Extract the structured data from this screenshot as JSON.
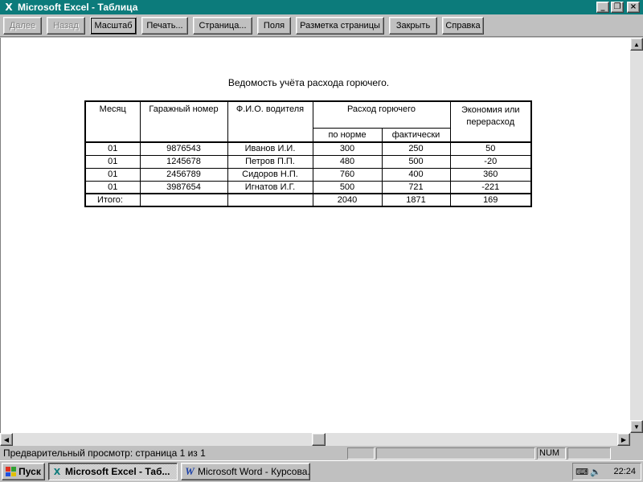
{
  "window": {
    "title": "Microsoft Excel - Таблица",
    "minimize": "_",
    "restore": "❐",
    "close": "×"
  },
  "toolbar": {
    "next": "Далее",
    "prev": "Назад",
    "zoom": "Масштаб",
    "print": "Печать...",
    "setup": "Страница...",
    "margins": "Поля",
    "page_break": "Разметка страницы",
    "close": "Закрыть",
    "help": "Справка"
  },
  "report": {
    "title": "Ведомость учёта расхода горючего.",
    "headers": {
      "month": "Месяц",
      "garage_no": "Гаражный номер",
      "driver": "Ф.И.О. водителя",
      "fuel": "Расход горючего",
      "norm": "по норме",
      "actual": "фактически",
      "economy": "Экономия или перерасход"
    },
    "rows": [
      {
        "month": "01",
        "garage_no": "9876543",
        "driver": "Иванов И.И.",
        "norm": "300",
        "actual": "250",
        "economy": "50"
      },
      {
        "month": "01",
        "garage_no": "1245678",
        "driver": "Петров П.П.",
        "norm": "480",
        "actual": "500",
        "economy": "-20"
      },
      {
        "month": "01",
        "garage_no": "2456789",
        "driver": "Сидоров Н.П.",
        "norm": "760",
        "actual": "400",
        "economy": "360"
      },
      {
        "month": "01",
        "garage_no": "3987654",
        "driver": "Игнатов И.Г.",
        "norm": "500",
        "actual": "721",
        "economy": "-221"
      }
    ],
    "total": {
      "label": "Итого:",
      "norm": "2040",
      "actual": "1871",
      "economy": "169"
    }
  },
  "statusbar": {
    "text": "Предварительный просмотр: страница 1 из 1",
    "num": "NUM"
  },
  "taskbar": {
    "start": "Пуск",
    "tasks": [
      {
        "label": "Microsoft Excel - Таб...",
        "icon": "excel-icon",
        "active": true
      },
      {
        "label": "Microsoft Word - Курсова...",
        "icon": "word-icon",
        "active": false
      }
    ],
    "clock": "22:24"
  }
}
